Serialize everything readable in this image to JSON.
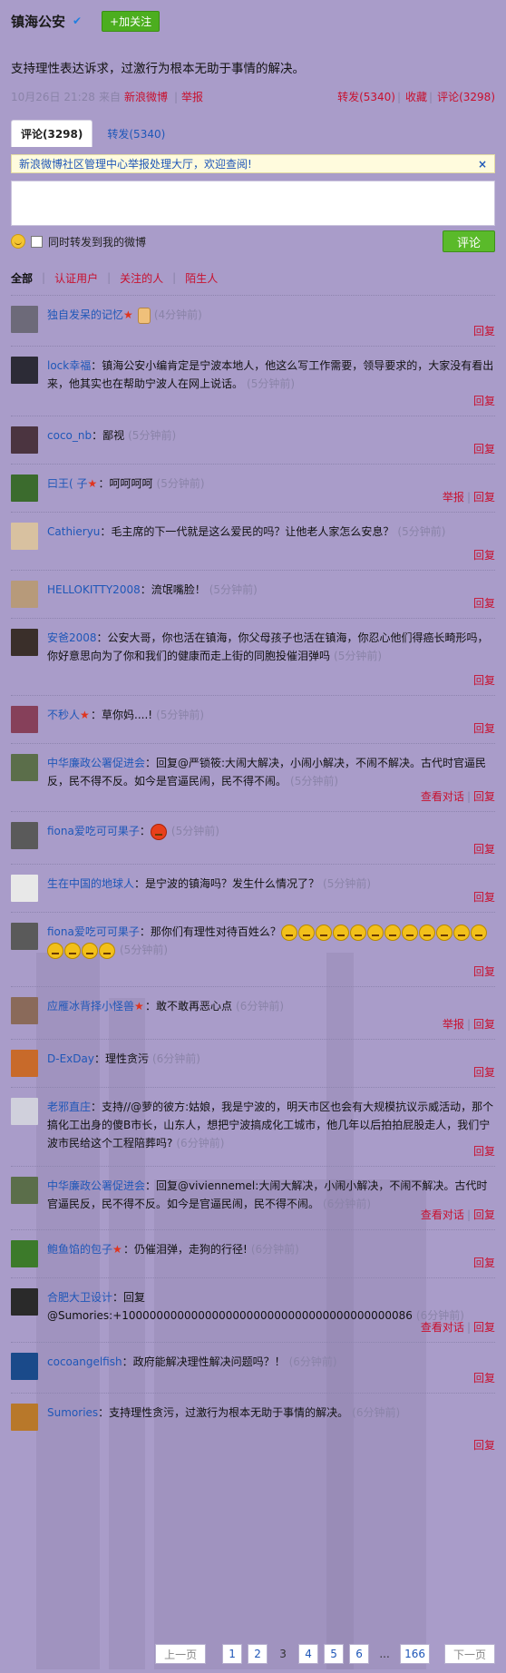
{
  "header": {
    "username": "镇海公安",
    "verified_icon": "v-badge-icon",
    "follow_label": "+加关注"
  },
  "post": {
    "text": "支持理性表达诉求，过激行为根本无助于事情的解决。"
  },
  "meta": {
    "time": "10月26日 21:28",
    "source_prefix": "来自",
    "source": "新浪微博",
    "report": "举报",
    "repost": "转发(5340)",
    "favorite": "收藏",
    "comment": "评论(3298)"
  },
  "tabs": {
    "comments": "评论(3298)",
    "reposts": "转发(5340)"
  },
  "notice": {
    "text": "新浪微博社区管理中心举报处理大厅，欢迎查阅!",
    "close": "×"
  },
  "composer": {
    "also_repost": "同时转发到我的微博",
    "submit": "评论"
  },
  "filters": {
    "all": "全部",
    "verified": "认证用户",
    "following": "关注的人",
    "strangers": "陌生人"
  },
  "comments": [
    {
      "name": "独自发呆的记忆",
      "badge": "star",
      "text": "",
      "extra": "thumb",
      "time": "(4分钟前)",
      "report": "",
      "dialog": "",
      "reply": "回复"
    },
    {
      "name": "lock幸福",
      "badge": "",
      "text": "：镇海公安小编肯定是宁波本地人，他这么写工作需要，领导要求的，大家没有看出来，他其实也在帮助宁波人在网上说话。",
      "extra": "",
      "time": "(5分钟前)",
      "report": "",
      "dialog": "",
      "reply": "回复"
    },
    {
      "name": "coco_nb",
      "badge": "",
      "text": "：鄙视",
      "extra": "",
      "time": "(5分钟前)",
      "report": "",
      "dialog": "",
      "reply": "回复"
    },
    {
      "name": "曰王(  子",
      "badge": "star",
      "text": "：呵呵呵呵",
      "extra": "",
      "time": "(5分钟前)",
      "report": "举报",
      "dialog": "",
      "reply": "回复"
    },
    {
      "name": "Cathieryu",
      "badge": "",
      "text": "：毛主席的下一代就是这么爱民的吗？让他老人家怎么安息？",
      "extra": "",
      "time": "(5分钟前)",
      "report": "",
      "dialog": "",
      "reply": "回复"
    },
    {
      "name": "HELLOKITTY2008",
      "badge": "",
      "text": "：流氓嘴脸！",
      "extra": "",
      "time": "(5分钟前)",
      "report": "",
      "dialog": "",
      "reply": "回复"
    },
    {
      "name": "安爸2008",
      "badge": "",
      "text": "：公安大哥，你也活在镇海，你父母孩子也活在镇海，你忍心他们得癌长畸形吗，你好意思向为了你和我们的健康而走上街的同胞投催泪弹吗",
      "extra": "",
      "time": "(5分钟前)",
      "report": "",
      "dialog": "",
      "reply": "回复"
    },
    {
      "name": "不秒人",
      "badge": "star",
      "text": "：草你妈....!",
      "extra": "",
      "time": "(5分钟前)",
      "report": "",
      "dialog": "",
      "reply": "回复"
    },
    {
      "name": "中华廉政公署促进会",
      "badge": "",
      "text": "：回复@严锁筱:大闹大解决，小闹小解决，不闹不解决。古代时官逼民反，民不得不反。如今是官逼民闹，民不得不闹。",
      "extra": "",
      "time": "(5分钟前)",
      "report": "",
      "dialog": "查看对话",
      "reply": "回复"
    },
    {
      "name": "fiona爱吃可可果子",
      "badge": "",
      "text": "：",
      "extra": "angry",
      "time": "(5分钟前)",
      "report": "",
      "dialog": "",
      "reply": "回复"
    },
    {
      "name": "生在中国的地球人",
      "badge": "",
      "text": "：是宁波的镇海吗？发生什么情况了？",
      "extra": "",
      "time": "(5分钟前)",
      "report": "",
      "dialog": "",
      "reply": "回复"
    },
    {
      "name": "fiona爱吃可可果子",
      "badge": "",
      "text": "：那你们有理性对待百姓么？",
      "extra": "emoji16",
      "time": "(5分钟前)",
      "report": "",
      "dialog": "",
      "reply": "回复"
    },
    {
      "name": "应雁冰背择小怪兽",
      "badge": "star",
      "text": "：敢不敢再恶心点",
      "extra": "",
      "time": "(6分钟前)",
      "report": "举报",
      "dialog": "",
      "reply": "回复"
    },
    {
      "name": "D-ExDay",
      "badge": "",
      "text": "：理性贪污",
      "extra": "",
      "time": "(6分钟前)",
      "report": "",
      "dialog": "",
      "reply": "回复"
    },
    {
      "name": "老邪直庄",
      "badge": "",
      "text": "：支持//@萝的彼方:姑娘，我是宁波的，明天市区也会有大规模抗议示威活动，那个搞化工出身的傻B市长，山东人，想把宁波搞成化工城市，他几年以后拍拍屁股走人，我们宁波市民给这个工程陪葬吗?",
      "extra": "",
      "time": "(6分钟前)",
      "report": "",
      "dialog": "",
      "reply": "回复"
    },
    {
      "name": "中华廉政公署促进会",
      "badge": "",
      "text": "：回复@viviennemel:大闹大解决，小闹小解决，不闹不解决。古代时官逼民反，民不得不反。如今是官逼民闹，民不得不闹。",
      "extra": "",
      "time": "(6分钟前)",
      "report": "",
      "dialog": "查看对话",
      "reply": "回复"
    },
    {
      "name": "鲍鱼馅的包子",
      "badge": "star",
      "text": "：仍催泪弹，走狗的行径!",
      "extra": "",
      "time": "(6分钟前)",
      "report": "",
      "dialog": "",
      "reply": "回复"
    },
    {
      "name": "合肥大卫设计",
      "badge": "",
      "text": "：回复@Sumories:+100000000000000000000000000000000000000086",
      "extra": "",
      "time": "(6分钟前)",
      "report": "",
      "dialog": "查看对话",
      "reply": "回复"
    },
    {
      "name": "cocoangelfish",
      "badge": "",
      "text": "：政府能解决理性解决问题吗？！",
      "extra": "",
      "time": "(6分钟前)",
      "report": "",
      "dialog": "",
      "reply": "回复"
    },
    {
      "name": "Sumories",
      "badge": "",
      "text": "：支持理性贪污，过激行为根本无助于事情的解决。",
      "extra": "",
      "time": "(6分钟前)",
      "report": "",
      "dialog": "",
      "reply": "回复"
    }
  ],
  "pager": {
    "prev": "上一页",
    "pages": [
      "1",
      "2",
      "3",
      "4",
      "5",
      "6",
      "...",
      "166"
    ],
    "current": "3",
    "next": "下一页"
  },
  "colors": {
    "background": "#a99cc9",
    "link": "#1f57b8",
    "alert": "#c8102e",
    "button_green": "#5aba2a"
  }
}
